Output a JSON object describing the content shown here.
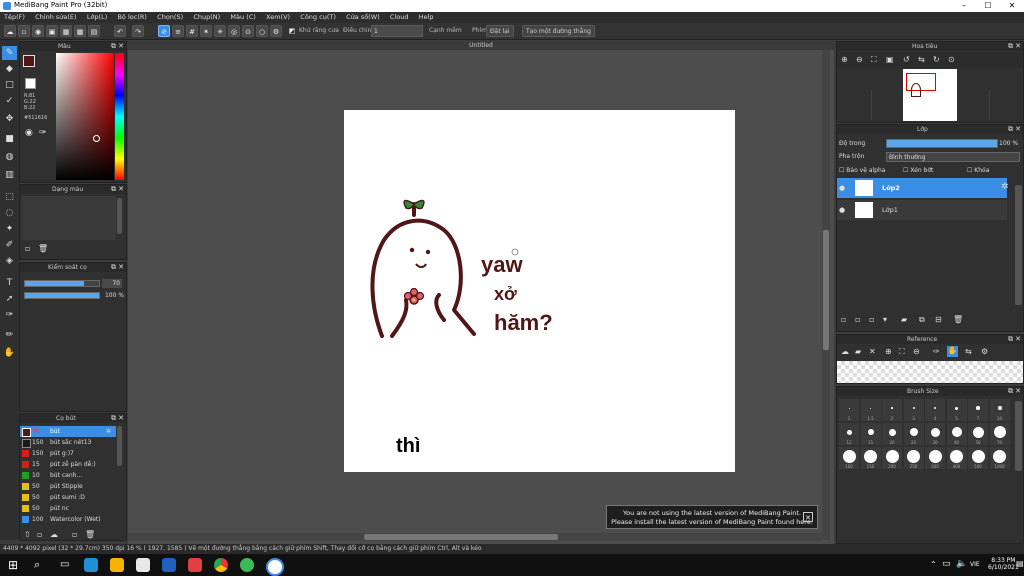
{
  "window": {
    "title": "MediBang Paint Pro (32bit)"
  },
  "menu": [
    "Tệp(F)",
    "Chỉnh sửa(E)",
    "Lớp(L)",
    "Bộ lọc(R)",
    "Chọn(S)",
    "Chụp(N)",
    "Màu (C)",
    "Xem(V)",
    "Công cụ(T)",
    "Cửa sổ(W)",
    "Cloud",
    "Help"
  ],
  "toolbar": {
    "antialias_label": "Khử răng cưa",
    "correction_label": "Điều chỉnh",
    "correction_value": "1",
    "edge_label": "Cạnh mềm",
    "pen_label": "Phím",
    "reset_label": "Đặt lại",
    "straight_line_label": "Tạo một đường thẳng"
  },
  "panels": {
    "color": {
      "title": "Màu",
      "r": "R:81",
      "g": "G:22",
      "b": "B:22",
      "hex": "#511616",
      "primary": "#511616",
      "secondary": "#ffffff"
    },
    "color_history": {
      "title": "Dạng màu"
    },
    "brush_control": {
      "title": "Kiểm soát cọ",
      "size_value": "70",
      "opacity_value": "100 %"
    },
    "brushes": {
      "title": "Cọ bút",
      "items": [
        {
          "size": "70",
          "name": "bút",
          "color": "#511616"
        },
        {
          "size": "150",
          "name": "bút sắc nét13",
          "color": "#1a1a1a"
        },
        {
          "size": "150",
          "name": "pút g:)7",
          "color": "#d02020"
        },
        {
          "size": "15",
          "name": "pút zễ pàn dễ:)",
          "color": "#d02020"
        },
        {
          "size": "10",
          "name": "bút canh...",
          "color": "#20a020"
        },
        {
          "size": "50",
          "name": "pút Stipple",
          "color": "#e0c020"
        },
        {
          "size": "50",
          "name": "pút sumi :D",
          "color": "#e0c020"
        },
        {
          "size": "50",
          "name": "pút nc",
          "color": "#e0c020"
        },
        {
          "size": "100",
          "name": "Watercolor (Wet)",
          "color": "#3a8ee6"
        }
      ]
    },
    "navigator": {
      "title": "Hoa tiêu"
    },
    "layer": {
      "title": "Lớp",
      "opacity_label": "Độ trong",
      "opacity_value": "100 %",
      "opacity_fraction": 1.0,
      "blend_label": "Pha trộn",
      "blend_value": "Bình thường",
      "protect_alpha": "Bảo vệ alpha",
      "clipping": "Xén bớt",
      "lock": "Khóa",
      "layers": [
        {
          "name": "Lớp2",
          "selected": true
        },
        {
          "name": "Lớp1",
          "selected": false
        }
      ]
    },
    "reference": {
      "title": "Reference"
    },
    "brush_size": {
      "title": "Brush Size",
      "row1": [
        "1",
        "1.5",
        "2",
        "3",
        "4",
        "5",
        "7",
        "10"
      ],
      "row2": [
        "12",
        "15",
        "20",
        "25",
        "30",
        "40",
        "50",
        "70"
      ],
      "row3": [
        "100",
        "150",
        "200",
        "250",
        "300",
        "400",
        "500",
        "1000"
      ]
    }
  },
  "document": {
    "tab": "Untitled"
  },
  "canvas_text": {
    "word1": "yaw",
    "word2": "xở",
    "word3": "hăm?",
    "word4": "thì"
  },
  "status": {
    "text": "4409 * 4092 pixel  (32 * 29.7cm)  350 dpi  16 %  ( 1927, 1585 )  Vẽ một đường thẳng bằng cách giữ phím Shift, Thay đổi cỡ cọ bằng cách giữ phím Ctrl, Alt và kéo"
  },
  "notice": {
    "line1": "You are not using the latest version of MediBang Paint.",
    "line2": "Please install the latest version of MediBang Paint found here."
  },
  "taskbar": {
    "time": "8:33 PM",
    "date": "6/10/2021",
    "lang": "VIE"
  }
}
